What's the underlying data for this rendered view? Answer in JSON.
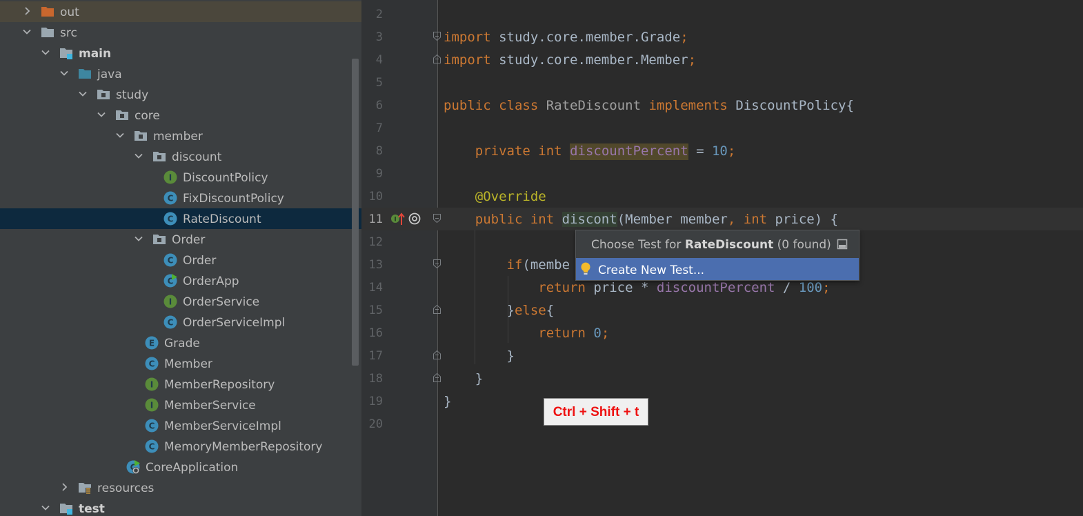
{
  "project_tree": {
    "items": [
      {
        "label": "out",
        "type": "folder-orange",
        "chevron": "right"
      },
      {
        "label": "src",
        "type": "folder",
        "chevron": "down"
      },
      {
        "label": "main",
        "type": "module",
        "chevron": "down",
        "bold": true
      },
      {
        "label": "java",
        "type": "folder-blue",
        "chevron": "down"
      },
      {
        "label": "study",
        "type": "package",
        "chevron": "down"
      },
      {
        "label": "core",
        "type": "package",
        "chevron": "down"
      },
      {
        "label": "member",
        "type": "package",
        "chevron": "down"
      },
      {
        "label": "discount",
        "type": "package",
        "chevron": "down"
      },
      {
        "label": "DiscountPolicy",
        "type": "interface",
        "badge": "I"
      },
      {
        "label": "FixDiscountPolicy",
        "type": "class",
        "badge": "C"
      },
      {
        "label": "RateDiscount",
        "type": "class",
        "badge": "C",
        "selected": true
      },
      {
        "label": "Order",
        "type": "package",
        "chevron": "down"
      },
      {
        "label": "Order",
        "type": "class",
        "badge": "C"
      },
      {
        "label": "OrderApp",
        "type": "class-run",
        "badge": "C"
      },
      {
        "label": "OrderService",
        "type": "interface",
        "badge": "I"
      },
      {
        "label": "OrderServiceImpl",
        "type": "class",
        "badge": "C"
      },
      {
        "label": "Grade",
        "type": "enum",
        "badge": "E"
      },
      {
        "label": "Member",
        "type": "class",
        "badge": "C"
      },
      {
        "label": "MemberRepository",
        "type": "interface",
        "badge": "I"
      },
      {
        "label": "MemberService",
        "type": "interface",
        "badge": "I"
      },
      {
        "label": "MemberServiceImpl",
        "type": "class",
        "badge": "C"
      },
      {
        "label": "MemoryMemberRepository",
        "type": "class",
        "badge": "C"
      },
      {
        "label": "CoreApplication",
        "type": "spring-app",
        "badge": "C"
      },
      {
        "label": "resources",
        "type": "resources",
        "chevron": "right"
      },
      {
        "label": "test",
        "type": "module",
        "chevron": "down",
        "bold": true
      }
    ]
  },
  "editor": {
    "line_numbers": [
      "2",
      "3",
      "4",
      "5",
      "6",
      "7",
      "8",
      "9",
      "10",
      "11",
      "12",
      "13",
      "14",
      "15",
      "16",
      "17",
      "18",
      "19",
      "20"
    ],
    "current_line": "11",
    "code": {
      "l3": {
        "kw": "import",
        "rest": " study.core.member.Grade",
        "semi": ";"
      },
      "l4": {
        "kw": "import",
        "rest": " study.core.member.Member",
        "semi": ";"
      },
      "l6": {
        "kw1": "public class",
        "cls": "RateDiscount",
        "kw2": "implements",
        "rest": "DiscountPolicy{"
      },
      "l8": {
        "kw": "private int",
        "field": "discountPercent",
        "eq": " = ",
        "num": "10",
        "semi": ";"
      },
      "l10": {
        "ann": "@Override"
      },
      "l11": {
        "kw1": "public int",
        "name": "discont",
        "p1": "(Member member",
        "comma": ",",
        "kw2": "int",
        "p2": " price) {"
      },
      "l13": {
        "kw": "if",
        "rest": "(membe"
      },
      "l14": {
        "kw": "return",
        "rest1": " price * ",
        "field": "discountPercent",
        "rest2": " / ",
        "num": "100",
        "semi": ";"
      },
      "l15": {
        "b1": "}",
        "kw": "else",
        "b2": "{"
      },
      "l16": {
        "kw": "return",
        "num": "0",
        "semi": ";"
      },
      "l17": {
        "text": "}"
      },
      "l18": {
        "text": "}"
      },
      "l19": {
        "text": "}"
      }
    }
  },
  "popup": {
    "title_prefix": "Choose Test for ",
    "title_class": "RateDiscount",
    "title_suffix": " (0 found)",
    "item": "Create New Test..."
  },
  "shortcut_overlay": {
    "text": "Ctrl + Shift + t"
  },
  "colors": {
    "keyword": "#cc7832",
    "number": "#6897bb",
    "field": "#9876aa",
    "annotation": "#bbb529",
    "selection": "#0d293e",
    "popup_highlight": "#4b6eaf",
    "shortcut_text": "#ee1111"
  }
}
